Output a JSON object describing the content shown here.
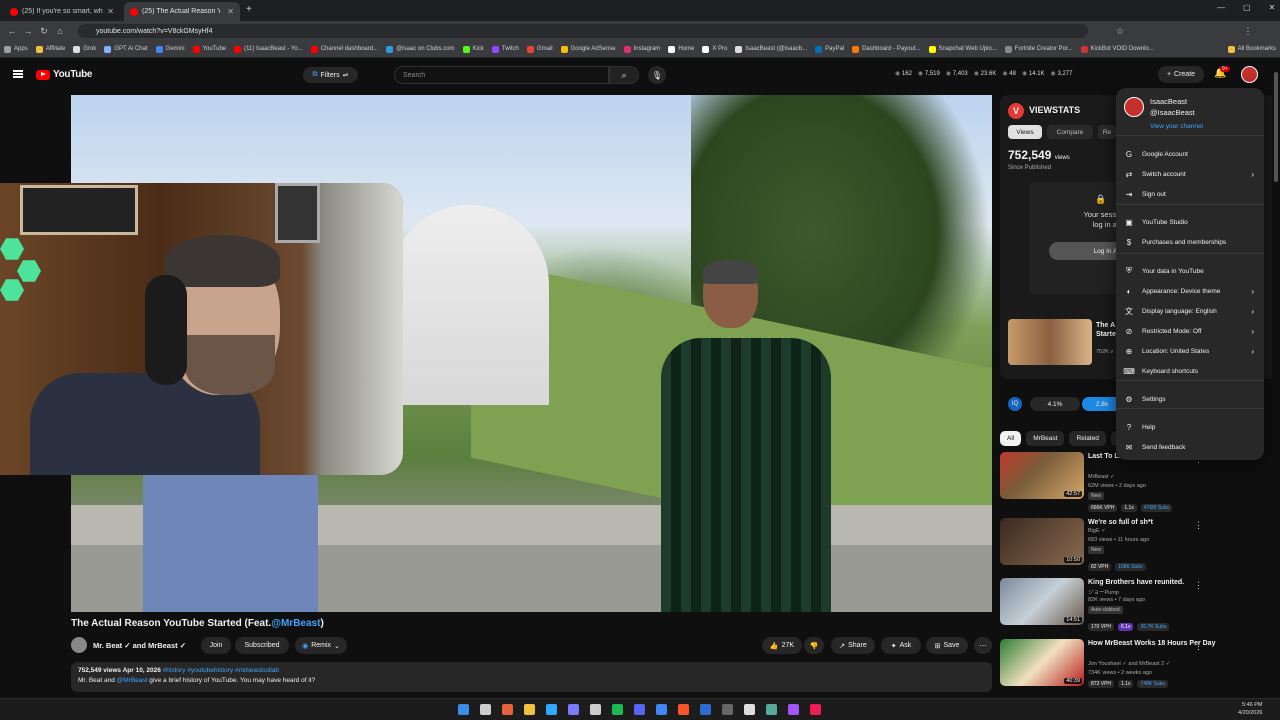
{
  "browser": {
    "tabs": [
      {
        "label": "(25) If you're so smart, why are"
      },
      {
        "label": "(25) The Actual Reason YouTube"
      }
    ],
    "url": "youtube.com/watch?v=V8ckGMsyHf4",
    "bookmarks": [
      "Apps",
      "Affiliate",
      "Grok",
      "GPT Ai Chat",
      "Gemini",
      "YouTube",
      "(11) IsaacBeast - Yo...",
      "Channel dashboard...",
      "@isaac on Clubs.com",
      "Kick",
      "Twitch",
      "Gmail",
      "Google AdSense",
      "Instagram",
      "Home",
      "X Pro",
      "IsaacBeast (@isaacb...",
      "PayPal",
      "Dashboard - Payout...",
      "Snapchat Web Uplo...",
      "Fortnite Creator Por...",
      "KickBot VOID Downlo...",
      "All Bookmarks"
    ]
  },
  "header": {
    "logo": "YouTube",
    "filters": "Filters",
    "search_placeholder": "Search",
    "stats": [
      "162",
      "7,519",
      "7,403",
      "23.6K",
      "48",
      "14.1K",
      "3,277"
    ],
    "create": "Create",
    "notif_count": "9+"
  },
  "video": {
    "title_prefix": "The Actual Reason YouTube Started (Feat.",
    "title_mention": "@MrBeast",
    "title_suffix": ")",
    "channel": "Mr. Beat ✓ and MrBeast ✓",
    "join": "Join",
    "subscribed": "Subscribed",
    "remix": "Remix",
    "likes": "27K",
    "share": "Share",
    "ask": "Ask",
    "save": "Save",
    "desc_stats": "752,549 views  Apr 10, 2026",
    "desc_tags": "#history #youtubehistory #mrbeastcollab",
    "desc_line_a": "Mr. Beat and ",
    "desc_mention": "@MrBeast",
    "desc_line_b": " give a brief history of YouTube. You may have heard of it?"
  },
  "viewstats": {
    "title": "VIEWSTATS",
    "tabs": [
      "Views",
      "Compare",
      "Re"
    ],
    "views": "752,549",
    "views_unit": "views",
    "since": "Since Published",
    "session_l1": "Your session has exp",
    "session_l2": "log in again to c",
    "login": "Log In Aga",
    "rel_title": "The A Starte",
    "rel_meta": "752K v",
    "ratio_a": "4.1%",
    "ratio_b": "2.8x"
  },
  "chips": [
    "All",
    "MrBeast",
    "Related",
    "V"
  ],
  "recommendations": [
    {
      "title": "Last To L... Wins $250,000",
      "channel": "MrBeast ✓",
      "meta": "62M views • 2 days ago",
      "badge": "New",
      "duration": "42:57",
      "stats": [
        "666K VPH",
        "1.1x",
        "476M Subs"
      ]
    },
    {
      "title": "We're so full of sh*t",
      "channel": "BigE ✓",
      "meta": "683 views • 11 hours ago",
      "badge": "New",
      "duration": "10:50",
      "stats": [
        "82 VPH",
        "108K Subs"
      ]
    },
    {
      "title": "King Brothers have reunited.",
      "channel": "ジョーPump",
      "meta": "82K views • 7 days ago",
      "badge": "Auto-dubbed",
      "duration": "14:51",
      "stats": [
        "170 VPH",
        "6.1x",
        "26.7K Subs"
      ]
    },
    {
      "title": "How MrBeast Works 18 Hours Per Day",
      "channel": "Jon Youshaei ✓ and MrBeast 2 ✓",
      "meta": "734K views • 2 weeks ago",
      "badge": "",
      "duration": "40:39",
      "stats": [
        "873 VPH",
        "1.1x",
        "748K Subs"
      ]
    }
  ],
  "menu": {
    "name": "IsaacBeast",
    "handle": "@IsaacBeast",
    "view_channel": "View your channel",
    "items": [
      "Google Account",
      "Switch account",
      "Sign out",
      "YouTube Studio",
      "Purchases and memberships",
      "Your data in YouTube",
      "Appearance: Device theme",
      "Display language: English",
      "Restricted Mode: Off",
      "Location: United States",
      "Keyboard shortcuts",
      "Settings",
      "Help",
      "Send feedback"
    ]
  },
  "taskbar": {
    "time": "5:46 PM",
    "date": "4/20/2026"
  }
}
